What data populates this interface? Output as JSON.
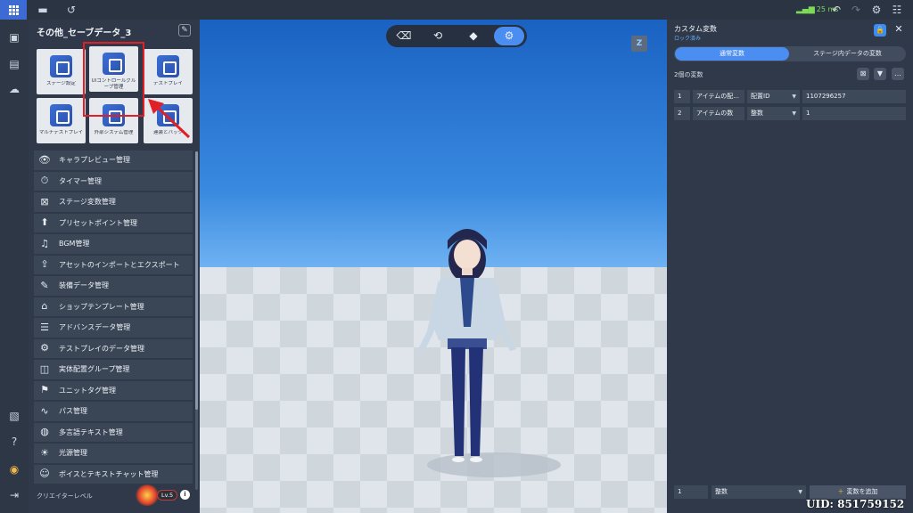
{
  "topbar": {
    "ping": "25 ms",
    "icons": [
      "apps-grid-icon",
      "folder-icon",
      "history-icon",
      "signal-icon",
      "undo-icon",
      "redo-icon",
      "gear-icon",
      "sliders-icon"
    ]
  },
  "rail": {
    "icons": [
      "save-icon",
      "archive-icon",
      "upload-icon",
      "clipboard-check-icon",
      "help-icon",
      "globe-icon",
      "exit-icon"
    ]
  },
  "left_panel": {
    "title": "その他_セーブデータ_3",
    "tiles": [
      {
        "label": "ステージ設定"
      },
      {
        "label": "UIコントロールグループ管理"
      },
      {
        "label": "テストプレイ"
      },
      {
        "label": "マルチテストプレイ"
      },
      {
        "label": "外部システム管理"
      },
      {
        "label": "連装とバック"
      }
    ],
    "menu": [
      {
        "label": "キャラプレビュー管理",
        "icon": "👁"
      },
      {
        "label": "タイマー管理",
        "icon": "⏱"
      },
      {
        "label": "ステージ変数管理",
        "icon": "⊠"
      },
      {
        "label": "プリセットポイント管理",
        "icon": "⬆"
      },
      {
        "label": "BGM管理",
        "icon": "♫"
      },
      {
        "label": "アセットのインポートとエクスポート",
        "icon": "⇪"
      },
      {
        "label": "装備データ管理",
        "icon": "✎"
      },
      {
        "label": "ショップテンプレート管理",
        "icon": "⌂"
      },
      {
        "label": "アドバンスデータ管理",
        "icon": "☰"
      },
      {
        "label": "テストプレイのデータ管理",
        "icon": "⚙"
      },
      {
        "label": "実体配置グループ管理",
        "icon": "◫"
      },
      {
        "label": "ユニットタグ管理",
        "icon": "⚑"
      },
      {
        "label": "パス管理",
        "icon": "∿"
      },
      {
        "label": "多言語テキスト管理",
        "icon": "◍"
      },
      {
        "label": "光源管理",
        "icon": "☀"
      },
      {
        "label": "ボイスとテキストチャット管理",
        "icon": "☺"
      }
    ],
    "creator_level_label": "クリエイターレベル",
    "level": "Lv.5"
  },
  "viewport": {
    "toolbar_icons": [
      "eraser-icon",
      "rotate-cube-icon",
      "cube-icon",
      "settings-target-icon"
    ],
    "z_badge": "Z"
  },
  "right_panel": {
    "title": "カスタム変数",
    "subtitle": "ロック済み",
    "tabs": [
      {
        "label": "通常変数",
        "active": true
      },
      {
        "label": "ステージ内データの変数",
        "active": false
      }
    ],
    "var_count": "2個の変数",
    "variables": [
      {
        "index": "1",
        "name": "アイテムの配...",
        "type": "配置ID",
        "value": "1107296257"
      },
      {
        "index": "2",
        "name": "アイテムの数",
        "type": "整数",
        "value": "1"
      }
    ],
    "bottom": {
      "count": "1",
      "type": "整数",
      "add_label": "変数を追加"
    }
  },
  "uid": "UID: 851759152",
  "colors": {
    "accent": "#4a8ef2",
    "panel": "#2f3949",
    "highlight": "#e01f26"
  }
}
